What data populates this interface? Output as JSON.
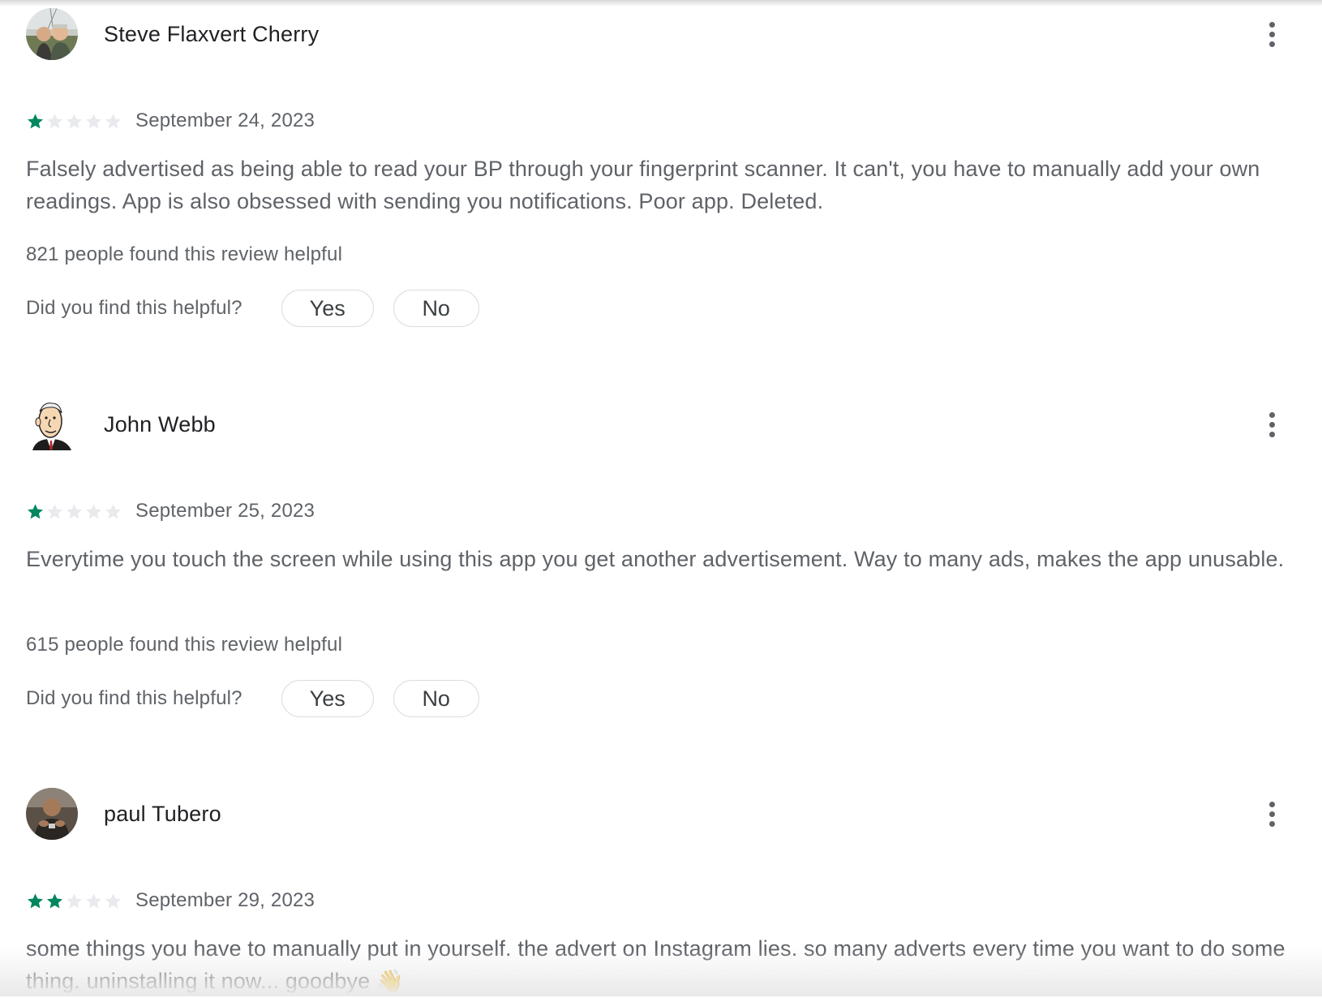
{
  "colors": {
    "star_filled": "#01875f",
    "star_empty": "#e8eaed",
    "text_primary": "#202124",
    "text_secondary": "#5f6368",
    "pill_border": "#dadce0"
  },
  "reviews": [
    {
      "author": "Steve Flaxvert Cherry",
      "avatar_icon": "photo-avatar-two-people",
      "rating": 1,
      "max_rating": 5,
      "date": "September 24, 2023",
      "text": "Falsely advertised as being able to read your BP through your fingerprint scanner. It can't, you have to manually add your own readings. App is also obsessed with sending you notifications. Poor app. Deleted.",
      "helpful_count_text": "821 people found this review helpful",
      "helpful_question": "Did you find this helpful?",
      "yes_label": "Yes",
      "no_label": "No",
      "more_icon": "more-vert-icon"
    },
    {
      "author": "John Webb",
      "avatar_icon": "cartoon-man-avatar",
      "rating": 1,
      "max_rating": 5,
      "date": "September 25, 2023",
      "text": "Everytime you touch the screen while using this app you get another advertisement. Way to many ads, makes the app unusable.",
      "helpful_count_text": "615 people found this review helpful",
      "helpful_question": "Did you find this helpful?",
      "yes_label": "Yes",
      "no_label": "No",
      "more_icon": "more-vert-icon"
    },
    {
      "author": "paul Tubero",
      "avatar_icon": "photo-avatar-person",
      "rating": 2,
      "max_rating": 5,
      "date": "September 29, 2023",
      "text": "some things you have to manually put in yourself. the advert on Instagram lies. so many adverts every time you want to do some thing. uninstalling it now... goodbye",
      "emoji": "👋",
      "more_icon": "more-vert-icon"
    }
  ]
}
